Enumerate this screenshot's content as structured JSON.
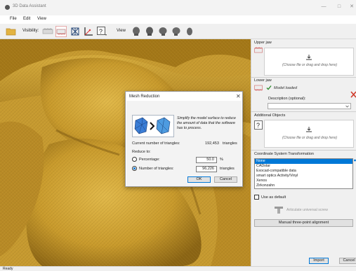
{
  "window": {
    "title": "3D Data Assistant"
  },
  "menu": {
    "file": "File",
    "edit": "Edit",
    "view": "View"
  },
  "toolbar": {
    "visibility_label": "Visibility:",
    "view_label": "View"
  },
  "panel": {
    "upper_jaw": {
      "title": "Upper jaw",
      "drop_text": "(Choose file or drag and drop here)"
    },
    "lower_jaw": {
      "title": "Lower jaw",
      "status": "Model loaded",
      "description_label": "Description (optional):",
      "description_value": ""
    },
    "additional": {
      "title": "Additional Objects",
      "drop_text": "(Choose file or drag and drop here)"
    },
    "coord": {
      "title": "Coordinate System Transformation",
      "options": [
        "None",
        "CADstar",
        "Exocad-compatible data",
        "smart optics Activity/Vinyl",
        "Xenos",
        "Zirkonzahn"
      ],
      "selected_index": 0,
      "use_default_label": "Use as default",
      "articulate_label": "Articulate universal screw",
      "manual_alignment_label": "Manual three-point alignment"
    },
    "import_label": "Import",
    "cancel_label": "Cancel"
  },
  "dialog": {
    "title": "Mesh Reduction",
    "description": "Simplify the model surface to reduce the amount of data that the software has to process.",
    "current_label": "Current number of triangles:",
    "current_value": "192,453",
    "current_unit": "triangles",
    "reduce_to_label": "Reduce to:",
    "percentage_label": "Percentage:",
    "percentage_value": "50.0",
    "percentage_unit": "%",
    "number_label": "Number of triangles:",
    "number_value": "96,226",
    "number_unit": "triangles",
    "mode": "number",
    "ok_label": "OK",
    "cancel_label": "Cancel"
  },
  "status": {
    "text": "Ready"
  },
  "colors": {
    "accent": "#0078d7",
    "model_gold": "#c99a2e",
    "ok_green": "#2e8b2e",
    "error_red": "#d03b2b"
  }
}
